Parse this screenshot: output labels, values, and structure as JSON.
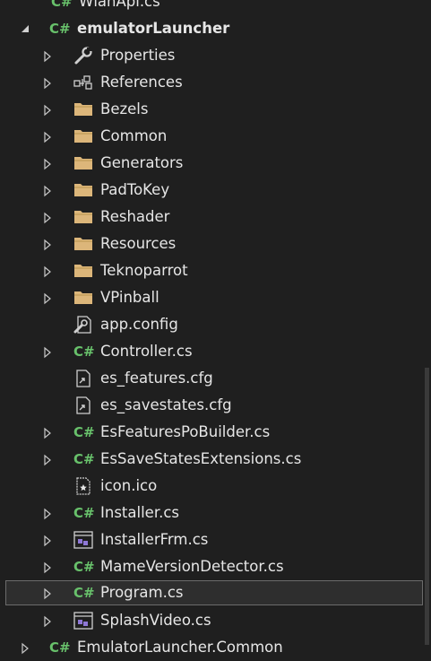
{
  "tree": {
    "top_partial": "WlanApi.cs",
    "project": "emulatorLauncher",
    "bottom_partial": "EmulatorLauncher.Common",
    "items": [
      {
        "label": "Properties",
        "icon": "wrench-icon",
        "expandable": true
      },
      {
        "label": "References",
        "icon": "references-icon",
        "expandable": true
      },
      {
        "label": "Bezels",
        "icon": "folder-icon",
        "expandable": true
      },
      {
        "label": "Common",
        "icon": "folder-icon",
        "expandable": true
      },
      {
        "label": "Generators",
        "icon": "folder-icon",
        "expandable": true
      },
      {
        "label": "PadToKey",
        "icon": "folder-icon",
        "expandable": true
      },
      {
        "label": "Reshader",
        "icon": "folder-icon",
        "expandable": true
      },
      {
        "label": "Resources",
        "icon": "folder-icon",
        "expandable": true
      },
      {
        "label": "Teknoparrot",
        "icon": "folder-icon",
        "expandable": true
      },
      {
        "label": "VPinball",
        "icon": "folder-icon",
        "expandable": true
      },
      {
        "label": "app.config",
        "icon": "config-file-icon",
        "expandable": false
      },
      {
        "label": "Controller.cs",
        "icon": "csharp-file-icon",
        "expandable": true
      },
      {
        "label": "es_features.cfg",
        "icon": "linked-file-icon",
        "expandable": false
      },
      {
        "label": "es_savestates.cfg",
        "icon": "linked-file-icon",
        "expandable": false
      },
      {
        "label": "EsFeaturesPoBuilder.cs",
        "icon": "csharp-file-icon",
        "expandable": true
      },
      {
        "label": "EsSaveStatesExtensions.cs",
        "icon": "csharp-file-icon",
        "expandable": true
      },
      {
        "label": "icon.ico",
        "icon": "ico-file-icon",
        "expandable": false
      },
      {
        "label": "Installer.cs",
        "icon": "csharp-file-icon",
        "expandable": true
      },
      {
        "label": "InstallerFrm.cs",
        "icon": "form-file-icon",
        "expandable": true
      },
      {
        "label": "MameVersionDetector.cs",
        "icon": "csharp-file-icon",
        "expandable": true
      },
      {
        "label": "Program.cs",
        "icon": "csharp-file-icon",
        "expandable": true,
        "selected": true
      },
      {
        "label": "SplashVideo.cs",
        "icon": "form-file-icon",
        "expandable": true
      }
    ]
  },
  "colors": {
    "background": "#1f1f1f",
    "text": "#e6e6e6",
    "folder": "#dcb67a",
    "csharp": "#68c16b",
    "form": "#8f78d6",
    "selection_border": "#6b6b6b"
  }
}
